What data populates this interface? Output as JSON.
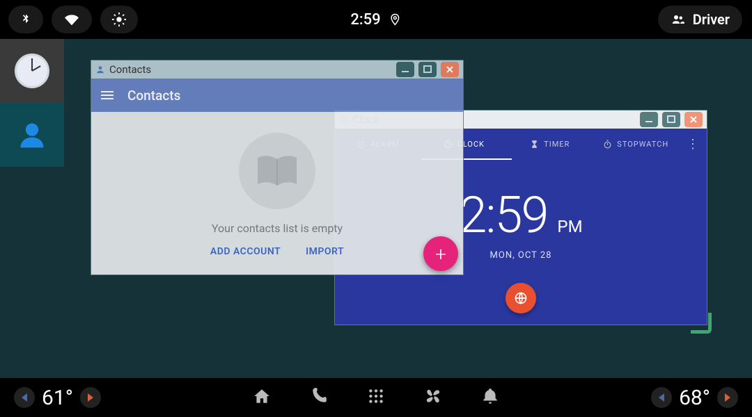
{
  "statusbar": {
    "time": "2:59",
    "profile_label": "Driver"
  },
  "rail": {
    "items": [
      "clock-app",
      "contacts-app"
    ]
  },
  "bottombar": {
    "temp_left": "61°",
    "temp_right": "68°"
  },
  "contacts_window": {
    "title": "Contacts",
    "appbar_title": "Contacts",
    "empty_message": "Your contacts list is empty",
    "action_add": "ADD ACCOUNT",
    "action_import": "IMPORT"
  },
  "clock_window": {
    "title": "Clock",
    "tabs": {
      "alarm": "ALARM",
      "clock": "CLOCK",
      "timer": "TIMER",
      "stopwatch": "STOPWATCH"
    },
    "time": "2:59",
    "ampm": "PM",
    "date": "MON, OCT 28"
  }
}
